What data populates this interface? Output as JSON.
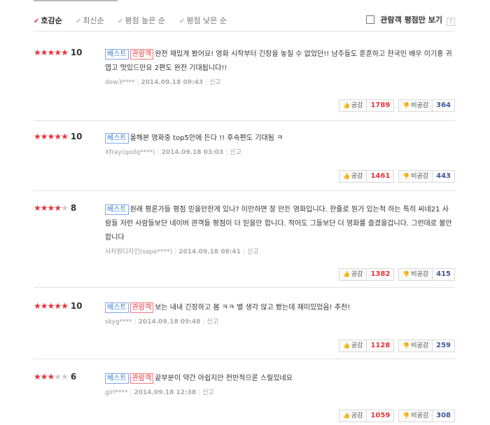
{
  "sort_options": [
    {
      "label": "호감순",
      "active": true
    },
    {
      "label": "최신순",
      "active": false
    },
    {
      "label": "평점 높은 순",
      "active": false
    },
    {
      "label": "평점 낮은 순",
      "active": false
    }
  ],
  "audience_filter": {
    "label": "관람객 평점만 보기",
    "help": "?"
  },
  "labels": {
    "like": "공감",
    "dislike": "비공감",
    "report": "신고",
    "best": "베스트",
    "audience": "관람객"
  },
  "reviews": [
    {
      "stars": 5,
      "score": "10",
      "best": true,
      "audience": true,
      "text": "완전 재밌게 봤어요! 영화 시작부터 긴장을 놓칠 수 없었던!! 남주들도 훈훈하고 한국인 배우 이기홍 귀엽고 멋있드만요 2편도 완전 기대됩니다!!",
      "user": "dew3****",
      "date": "2014.09.18 09:43",
      "likes": "1789",
      "dislikes": "364"
    },
    {
      "stars": 5,
      "score": "10",
      "best": true,
      "audience": false,
      "text": "올해본 영화중 top5안에 든다 !! 후속편도 기대됨 ㅋ",
      "user": "Xfray(qodq****)",
      "date": "2014.09.18 03:03",
      "likes": "1461",
      "dislikes": "443"
    },
    {
      "stars": 4,
      "score": "8",
      "best": true,
      "audience": false,
      "text": "원래 평론가들 평점 믿을만한게 있나? 이만하면 잘 만든 영화입니다. 한줄로 뭔가 있는척 하는 특히 씨네21 사람들 저런 사람들보단 네이버 관객들 평점이 더 믿을만 합니다. 적어도 그들보단 더 영화를 즐겼을겁니다. 그런데로 볼만합니다",
      "user": "사차원디자인(sape****)",
      "date": "2014.09.18 08:41",
      "likes": "1382",
      "dislikes": "415"
    },
    {
      "stars": 5,
      "score": "10",
      "best": true,
      "audience": true,
      "text": "보는 내내 긴장하고 봄 ㅋㅋ 별 생각 않고 봤는데 재미있었음! 추천!",
      "user": "skyg****",
      "date": "2014.09.18 09:48",
      "likes": "1128",
      "dislikes": "259"
    },
    {
      "stars": 3,
      "score": "6",
      "best": true,
      "audience": true,
      "text": "끝부분이 약간 아쉽지만 전반적으론 스릴있네요",
      "user": "girl****",
      "date": "2014.09.18 12:38",
      "likes": "1059",
      "dislikes": "308"
    }
  ]
}
